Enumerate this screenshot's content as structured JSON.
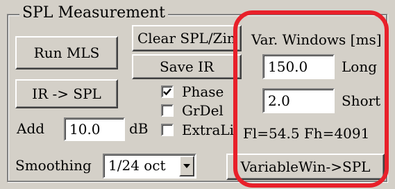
{
  "group": {
    "title": "SPL Measurement"
  },
  "buttons": {
    "run_mls": "Run MLS",
    "clear_spl": "Clear SPL/Zin",
    "save_ir": "Save IR",
    "ir_to_spl": "IR -> SPL",
    "variable_win_to_spl": "VariableWin->SPL"
  },
  "checkboxes": [
    {
      "label": "Phase",
      "checked": true
    },
    {
      "label": "GrDel",
      "checked": false
    },
    {
      "label": "ExtraLin",
      "checked": false
    }
  ],
  "add": {
    "label": "Add",
    "value": "10.0",
    "unit": "dB"
  },
  "smoothing": {
    "label": "Smoothing",
    "selected": "1/24 oct"
  },
  "var_windows": {
    "title": "Var. Windows [ms]",
    "long_value": "150.0",
    "long_label": "Long",
    "short_value": "2.0",
    "short_label": "Short",
    "freq_readout": "Fl=54.5 Fh=4091"
  },
  "colors": {
    "highlight": "#e8202a",
    "face": "#d4d0c8"
  }
}
